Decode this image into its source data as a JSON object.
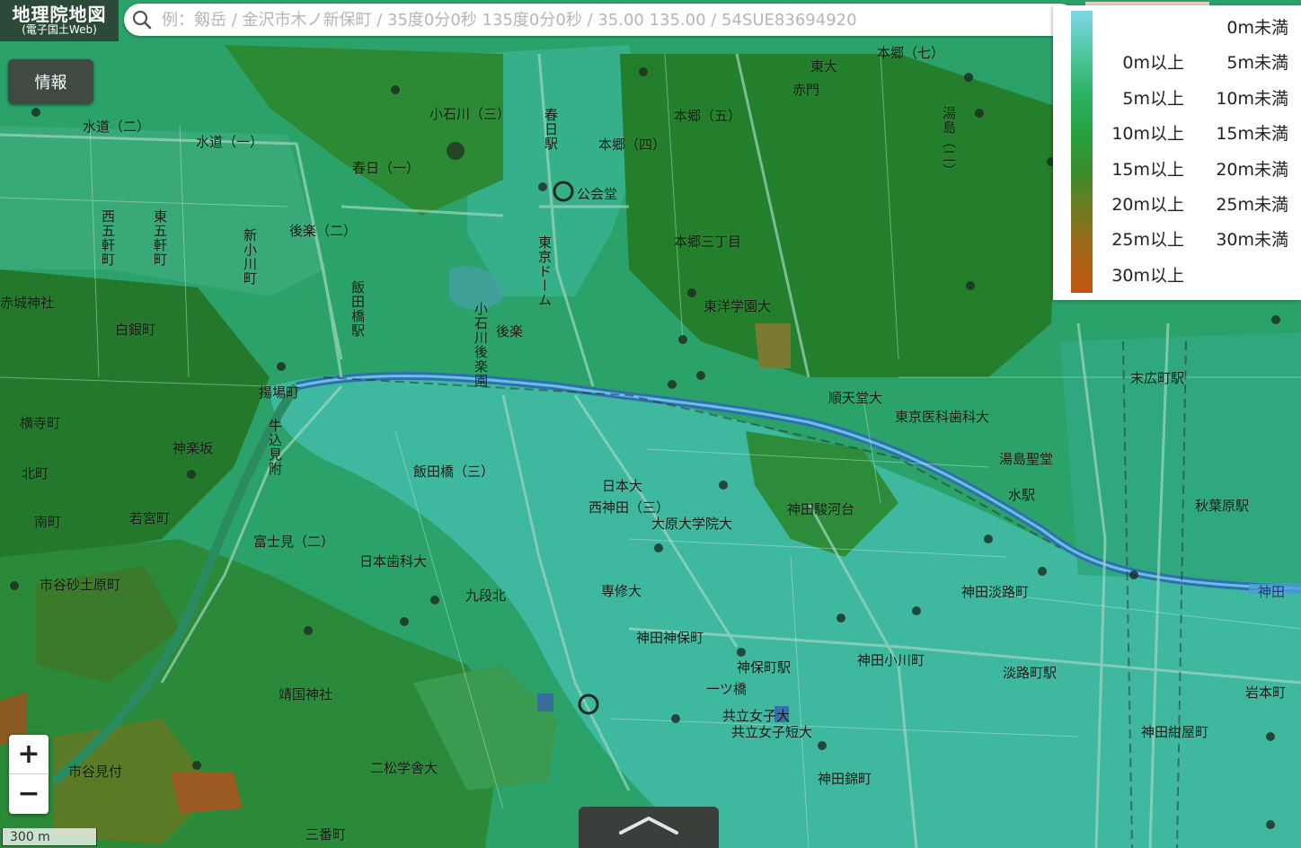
{
  "header": {
    "logo_title": "地理院地図",
    "logo_subtitle": "(電子国土Web)"
  },
  "search": {
    "icon": "search-icon",
    "placeholder": "例：剱岳 / 金沢市木ノ新保町 / 35度0分0秒 135度0分0秒 / 35.00 135.00 / 54SUE83694920"
  },
  "info_button": {
    "label": "情報"
  },
  "legend": {
    "title": "elevation-legend",
    "rows": [
      {
        "lo": "",
        "hi": "0m未満"
      },
      {
        "lo": "0m以上",
        "hi": "5m未満"
      },
      {
        "lo": "5m以上",
        "hi": "10m未満"
      },
      {
        "lo": "10m以上",
        "hi": "15m未満"
      },
      {
        "lo": "15m以上",
        "hi": "20m未満"
      },
      {
        "lo": "20m以上",
        "hi": "25m未満"
      },
      {
        "lo": "25m以上",
        "hi": "30m未満"
      },
      {
        "lo": "30m以上",
        "hi": ""
      }
    ],
    "colors": [
      "#7fd6e8",
      "#4fc7a0",
      "#2bb064",
      "#26a03a",
      "#3d8a2a",
      "#6b7d21",
      "#9a6818",
      "#c45410"
    ]
  },
  "zoom": {
    "in_label": "+",
    "out_label": "−"
  },
  "scale": {
    "label": "300 m"
  },
  "drawer": {
    "icon": "chevron-up-icon"
  },
  "map": {
    "places": [
      {
        "name": "place-suido-2",
        "text": "水道（二）"
      },
      {
        "name": "place-suido-1",
        "text": "水道（一）"
      },
      {
        "name": "place-koishikawa-3",
        "text": "小石川（三）"
      },
      {
        "name": "place-kasuga-eki",
        "text": "春日駅"
      },
      {
        "name": "place-hongo-5",
        "text": "本郷（五）"
      },
      {
        "name": "place-hongo-4",
        "text": "本郷（四）"
      },
      {
        "name": "place-hongo-7",
        "text": "本郷（七）"
      },
      {
        "name": "place-todai",
        "text": "東大"
      },
      {
        "name": "place-akamon",
        "text": "赤門"
      },
      {
        "name": "place-yushima-2",
        "text": "湯島（二）"
      },
      {
        "name": "place-kasuga-1",
        "text": "春日（一）"
      },
      {
        "name": "place-kokaido",
        "text": "公会堂"
      },
      {
        "name": "place-koraku-2",
        "text": "後楽（二）"
      },
      {
        "name": "place-shin-ogawamachi",
        "text": "新小川町"
      },
      {
        "name": "place-nishi-gokencho",
        "text": "西五軒町"
      },
      {
        "name": "place-higashi-gokencho",
        "text": "東五軒町"
      },
      {
        "name": "place-tokyo-dome",
        "text": "東京ドーム"
      },
      {
        "name": "place-tokyo-toyo",
        "text": "東洋学園大"
      },
      {
        "name": "place-akagi-jinja",
        "text": "赤城神社"
      },
      {
        "name": "place-shirogane",
        "text": "白銀町"
      },
      {
        "name": "place-iidabashi-eki",
        "text": "飯田橋駅"
      },
      {
        "name": "place-koishikawa-korakuen",
        "text": "小石川後楽園"
      },
      {
        "name": "place-koraku",
        "text": "後楽"
      },
      {
        "name": "place-hongo-3chome",
        "text": "本郷三丁目"
      },
      {
        "name": "place-juntendo",
        "text": "順天堂大"
      },
      {
        "name": "place-tokyo-ika",
        "text": "東京医科歯科大"
      },
      {
        "name": "place-yushima-seido",
        "text": "湯島聖堂"
      },
      {
        "name": "place-agebacho",
        "text": "揚場町"
      },
      {
        "name": "place-yokoteramachi",
        "text": "横寺町"
      },
      {
        "name": "place-kagurazaka",
        "text": "神楽坂"
      },
      {
        "name": "place-ushigome-mitsuke",
        "text": "牛込見附"
      },
      {
        "name": "place-iidabashi-3",
        "text": "飯田橋（三）"
      },
      {
        "name": "place-nihon-dai",
        "text": "日本大"
      },
      {
        "name": "place-nishi-kanda",
        "text": "西神田（三）"
      },
      {
        "name": "place-otemae",
        "text": "大原大学院大"
      },
      {
        "name": "place-kanda-surugadai",
        "text": "神田駿河台"
      },
      {
        "name": "place-ochanomizu",
        "text": "水駅"
      },
      {
        "name": "place-akihabara",
        "text": "秋葉原駅"
      },
      {
        "name": "place-kitamachi",
        "text": "北町"
      },
      {
        "name": "place-minamicho",
        "text": "南町"
      },
      {
        "name": "place-wakamiyacho",
        "text": "若宮町"
      },
      {
        "name": "place-fujimi-2",
        "text": "富士見（二）"
      },
      {
        "name": "place-nihon-shika",
        "text": "日本歯科大"
      },
      {
        "name": "place-kudan-kita",
        "text": "九段北"
      },
      {
        "name": "place-senshu",
        "text": "専修大"
      },
      {
        "name": "place-kanda-jinbocho",
        "text": "神田神保町"
      },
      {
        "name": "place-jinbocho-eki",
        "text": "神保町駅"
      },
      {
        "name": "place-kanda-ogawamachi",
        "text": "神田小川町"
      },
      {
        "name": "place-kanda-awajicho",
        "text": "神田淡路町"
      },
      {
        "name": "place-ichigaya",
        "text": "市谷砂土原町"
      },
      {
        "name": "place-yasukuni",
        "text": "靖国神社"
      },
      {
        "name": "place-hitotsubashi",
        "text": "一ツ橋"
      },
      {
        "name": "place-kyoritsu",
        "text": "共立女子大"
      },
      {
        "name": "place-kyoritsu-tan",
        "text": "共立女子短大"
      },
      {
        "name": "place-kanda-nishikicho",
        "text": "神田錦町"
      },
      {
        "name": "place-nishi-kudan",
        "text": "二松学舎大"
      },
      {
        "name": "place-ichigaya-mitsuke",
        "text": "市谷見付"
      },
      {
        "name": "place-sanbancho",
        "text": "三番町"
      },
      {
        "name": "place-kanda-konyacho",
        "text": "神田紺屋町"
      },
      {
        "name": "place-iwamotocho",
        "text": "岩本町"
      },
      {
        "name": "place-awajicho-eki",
        "text": "淡路町駅"
      },
      {
        "name": "place-suehirocho",
        "text": "末広町駅"
      },
      {
        "name": "place-kanda",
        "text": "神田"
      }
    ]
  }
}
